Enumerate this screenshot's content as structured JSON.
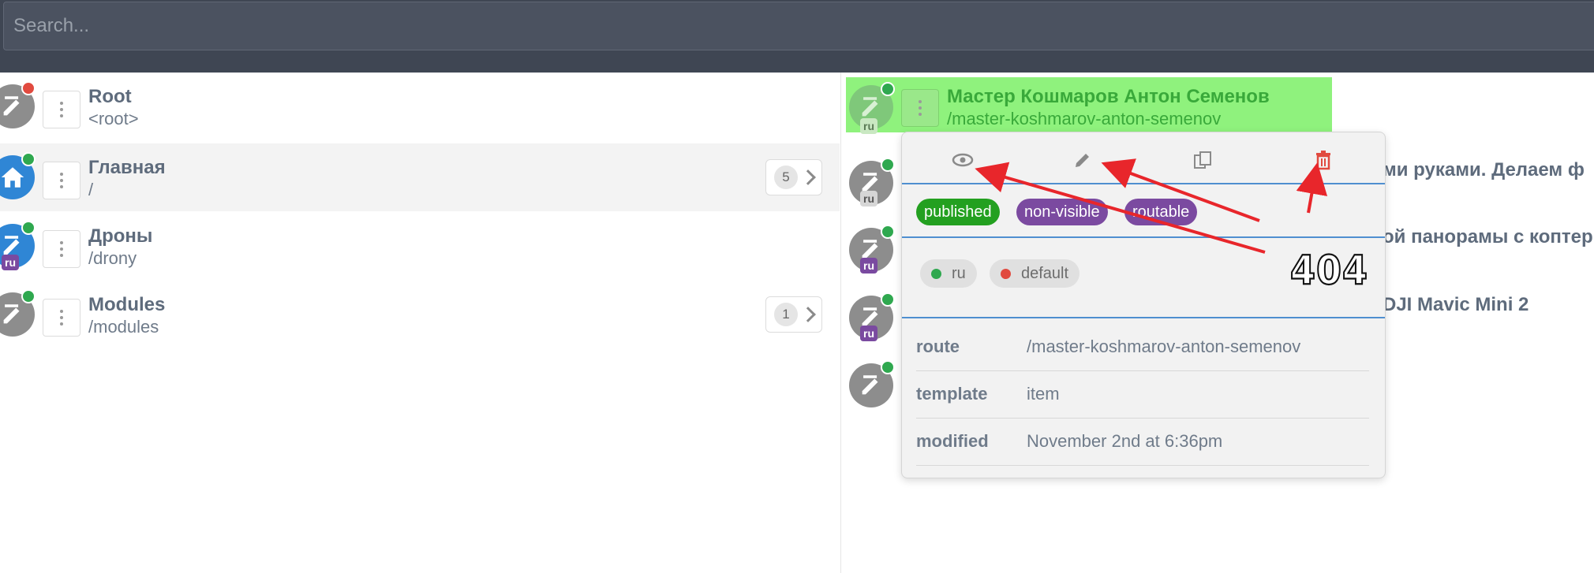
{
  "search": {
    "placeholder": "Search..."
  },
  "left_items": [
    {
      "title": "Root",
      "path": "<root>",
      "status": "red",
      "icon": "pencil-icon",
      "lang": ""
    },
    {
      "title": "Главная",
      "path": "/",
      "status": "green",
      "icon": "home-icon",
      "lang": "",
      "count": "5"
    },
    {
      "title": "Дроны",
      "path": "/drony",
      "status": "green",
      "icon": "pencil-icon",
      "lang": "ru"
    },
    {
      "title": "Modules",
      "path": "/modules",
      "status": "green",
      "icon": "pencil-icon",
      "lang": "",
      "count": "1"
    }
  ],
  "right_items": [
    {
      "title": "Мастер Кошмаров Антон Семенов",
      "path": "/master-koshmarov-anton-semenov",
      "lang": "ru"
    },
    {
      "title_fragment": "ми руками. Делаем ф",
      "lang": "ru"
    },
    {
      "title_fragment": "ой панорамы с коптер",
      "lang": "ru"
    },
    {
      "title_fragment": "DJI Mavic Mini 2",
      "lang": "ru"
    },
    {
      "title_fragment": ""
    }
  ],
  "popover": {
    "actions": [
      "eye-icon",
      "pencil-icon",
      "copy-icon",
      "trash-icon"
    ],
    "tags": [
      "published",
      "non-visible",
      "routable"
    ],
    "langs": [
      {
        "label": "ru",
        "color": "#2fa84f"
      },
      {
        "label": "default",
        "color": "#e14a3f"
      }
    ],
    "annotation": "404",
    "props": [
      {
        "key": "route",
        "value": "/master-koshmarov-anton-semenov"
      },
      {
        "key": "template",
        "value": "item"
      },
      {
        "key": "modified",
        "value": "November 2nd at 6:36pm"
      }
    ]
  },
  "colors": {
    "accent": "#4f8fd0",
    "highlight": "#8ff27d",
    "arrow": "#e8262b"
  }
}
